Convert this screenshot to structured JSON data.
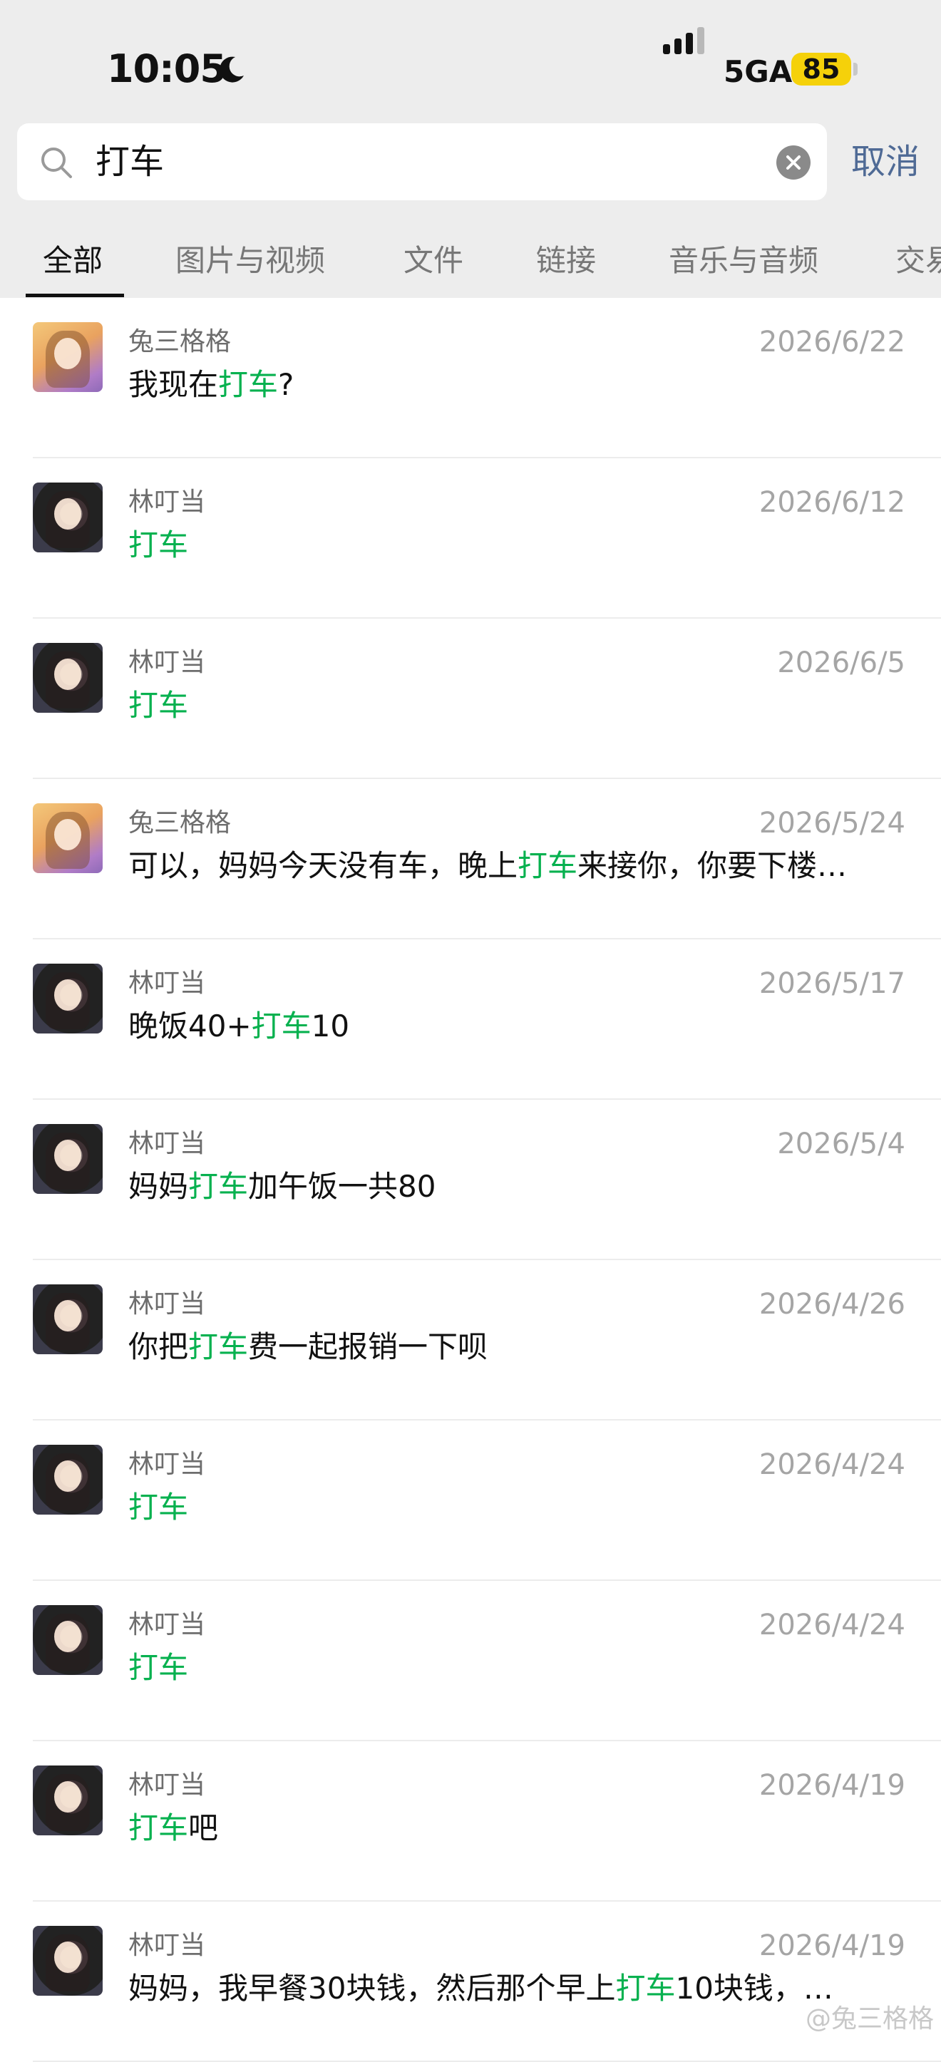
{
  "status_bar": {
    "time": "10:05",
    "network": "5GA",
    "battery": "85"
  },
  "search": {
    "query": "打车",
    "cancel": "取消"
  },
  "tabs": [
    "全部",
    "图片与视频",
    "文件",
    "链接",
    "音乐与音频",
    "交易"
  ],
  "results": [
    {
      "sender": "兔三格格",
      "date": "2026/6/22",
      "avatar": "warm",
      "parts": [
        {
          "t": "我现在"
        },
        {
          "t": "打车",
          "hl": true
        },
        {
          "t": "?"
        }
      ]
    },
    {
      "sender": "林叮当",
      "date": "2026/6/12",
      "avatar": "dark",
      "parts": [
        {
          "t": "打车",
          "hl": true
        }
      ]
    },
    {
      "sender": "林叮当",
      "date": "2026/6/5",
      "avatar": "dark",
      "parts": [
        {
          "t": "打车",
          "hl": true
        }
      ]
    },
    {
      "sender": "兔三格格",
      "date": "2026/5/24",
      "avatar": "warm",
      "parts": [
        {
          "t": "可以，妈妈今天没有车，晚上"
        },
        {
          "t": "打车",
          "hl": true
        },
        {
          "t": "来接你，你要下楼…"
        }
      ]
    },
    {
      "sender": "林叮当",
      "date": "2026/5/17",
      "avatar": "dark",
      "parts": [
        {
          "t": "晚饭40+"
        },
        {
          "t": "打车",
          "hl": true
        },
        {
          "t": "10"
        }
      ]
    },
    {
      "sender": "林叮当",
      "date": "2026/5/4",
      "avatar": "dark",
      "parts": [
        {
          "t": "妈妈"
        },
        {
          "t": "打车",
          "hl": true
        },
        {
          "t": "加午饭一共80"
        }
      ]
    },
    {
      "sender": "林叮当",
      "date": "2026/4/26",
      "avatar": "dark",
      "parts": [
        {
          "t": "你把"
        },
        {
          "t": "打车",
          "hl": true
        },
        {
          "t": "费一起报销一下呗"
        }
      ]
    },
    {
      "sender": "林叮当",
      "date": "2026/4/24",
      "avatar": "dark",
      "parts": [
        {
          "t": "打车",
          "hl": true
        }
      ]
    },
    {
      "sender": "林叮当",
      "date": "2026/4/24",
      "avatar": "dark",
      "parts": [
        {
          "t": "打车",
          "hl": true
        }
      ]
    },
    {
      "sender": "林叮当",
      "date": "2026/4/19",
      "avatar": "dark",
      "parts": [
        {
          "t": "打车",
          "hl": true
        },
        {
          "t": "吧"
        }
      ]
    },
    {
      "sender": "林叮当",
      "date": "2026/4/19",
      "avatar": "dark",
      "parts": [
        {
          "t": "妈妈，我早餐30块钱，然后那个早上"
        },
        {
          "t": "打车",
          "hl": true
        },
        {
          "t": "10块钱，…"
        }
      ]
    }
  ],
  "watermark": "@兔三格格",
  "colors": {
    "highlight": "#07b14f",
    "cancel": "#4f6a95",
    "battery": "#f5d10a",
    "header_bg": "#ededed"
  }
}
